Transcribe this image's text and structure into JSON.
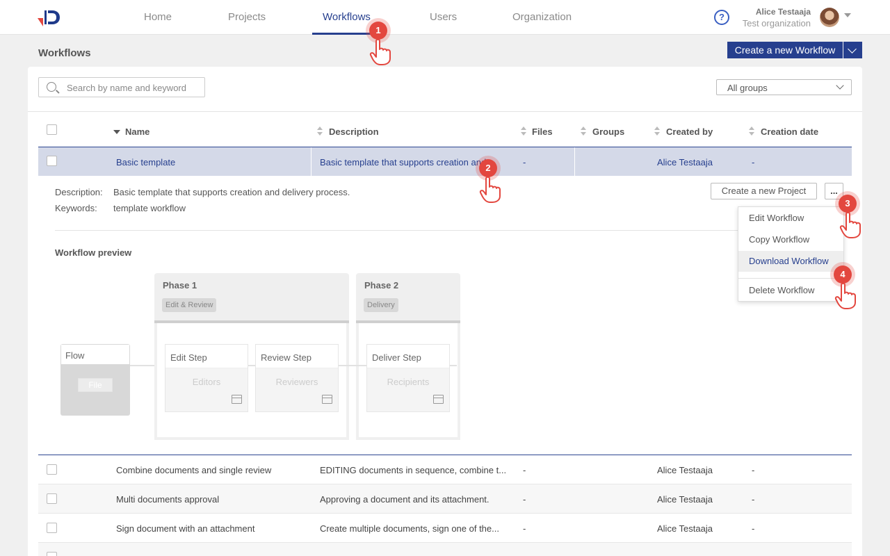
{
  "nav": {
    "items": [
      "Home",
      "Projects",
      "Workflows",
      "Users",
      "Organization"
    ],
    "active": "Workflows",
    "help_icon": "?",
    "user_name": "Alice Testaaja",
    "user_org": "Test organization"
  },
  "page": {
    "title": "Workflows",
    "create_label": "Create a new Workflow"
  },
  "filters": {
    "search_placeholder": "Search by name and keyword",
    "groups_value": "All groups"
  },
  "table": {
    "headers": [
      "Name",
      "Description",
      "Files",
      "Groups",
      "Created by",
      "Creation date"
    ],
    "selected": {
      "name": "Basic template",
      "description": "Basic template that supports creation and...",
      "files": "-",
      "created_by": "Alice Testaaja",
      "date": "-"
    },
    "rows": [
      {
        "name": "Combine documents and single review",
        "description": "EDITING documents in sequence, combine t...",
        "files": "-",
        "created_by": "Alice Testaaja",
        "date": "-"
      },
      {
        "name": "Multi documents approval",
        "description": "Approving a document and its attachment.",
        "files": "-",
        "created_by": "Alice Testaaja",
        "date": "-"
      },
      {
        "name": "Sign document with an attachment",
        "description": "Create multiple documents, sign one of the...",
        "files": "-",
        "created_by": "Alice Testaaja",
        "date": "-"
      }
    ]
  },
  "detail": {
    "description_label": "Description:",
    "description_value": "Basic template that supports creation and delivery process.",
    "keywords_label": "Keywords:",
    "keywords_value": "template workflow",
    "create_project_label": "Create a new Project",
    "more_label": "...",
    "preview_label": "Workflow preview"
  },
  "menu": {
    "items": [
      "Edit Workflow",
      "Copy Workflow",
      "Download Workflow",
      "Delete Workflow"
    ],
    "highlighted": "Download Workflow"
  },
  "diagram": {
    "flow_label": "Flow",
    "file_label": "File",
    "phases": [
      {
        "title": "Phase 1",
        "tag": "Edit & Review",
        "steps": [
          {
            "name": "Edit Step",
            "role": "Editors"
          },
          {
            "name": "Review Step",
            "role": "Reviewers"
          }
        ]
      },
      {
        "title": "Phase 2",
        "tag": "Delivery",
        "steps": [
          {
            "name": "Deliver Step",
            "role": "Recipients"
          }
        ]
      }
    ]
  },
  "callouts": [
    "1",
    "2",
    "3",
    "4"
  ],
  "colors": {
    "brand": "#263f8e",
    "callout": "#e3473f",
    "selected_row": "#d4d9e8"
  }
}
